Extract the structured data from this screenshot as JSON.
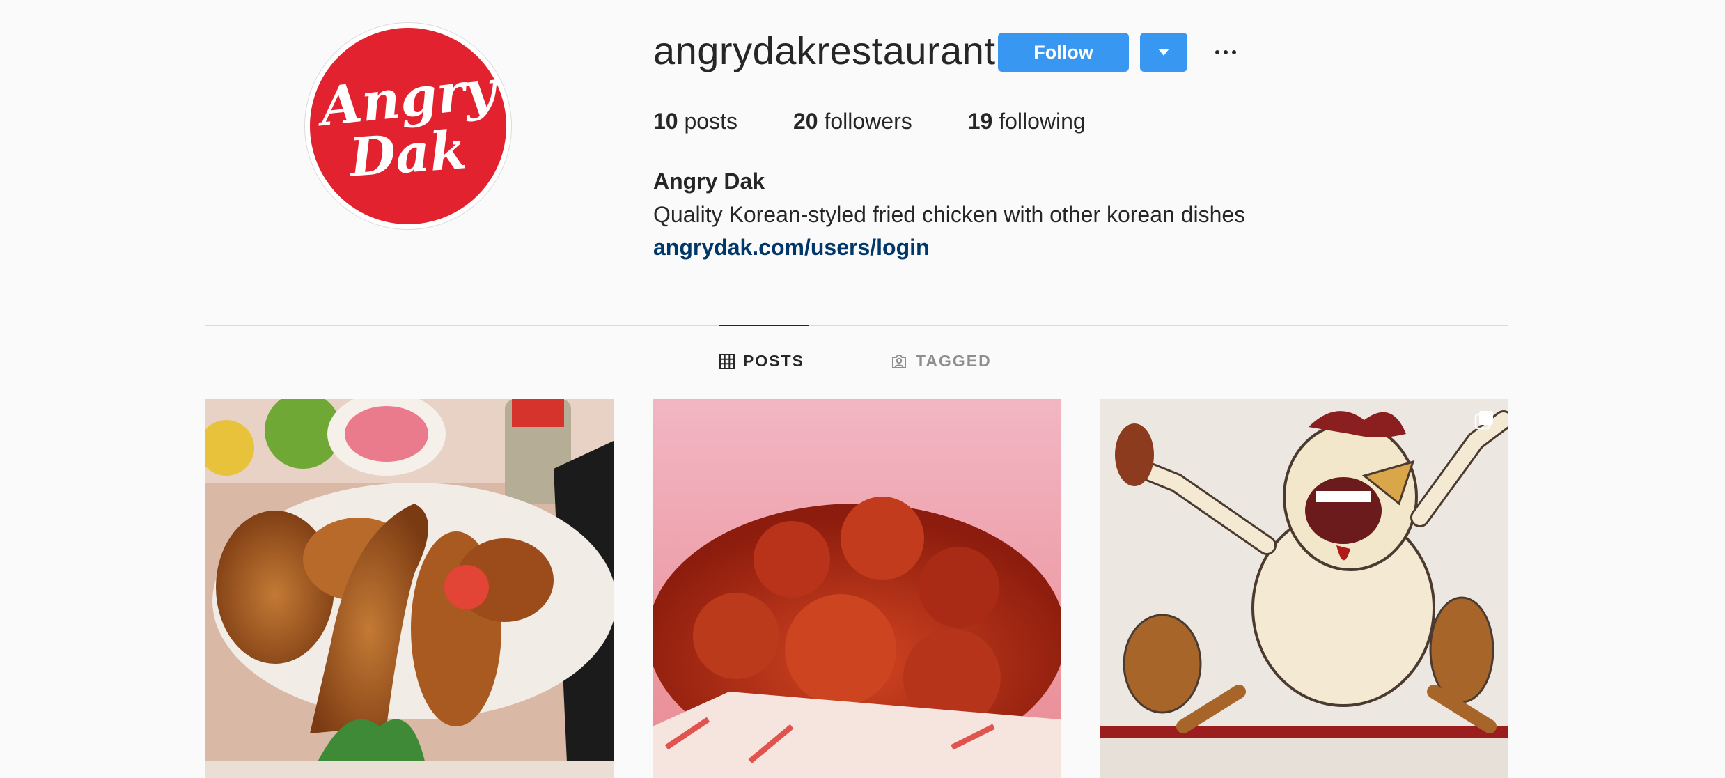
{
  "profile": {
    "avatar_text_line1": "Angry",
    "avatar_text_line2": "Dak",
    "username": "angrydakrestaurant",
    "follow_label": "Follow",
    "stats": {
      "posts_count": "10",
      "posts_label": "posts",
      "followers_count": "20",
      "followers_label": "followers",
      "following_count": "19",
      "following_label": "following"
    },
    "full_name": "Angry Dak",
    "bio": "Quality Korean-styled fried chicken with other korean dishes",
    "link": "angrydak.com/users/login"
  },
  "tabs": [
    {
      "label": "POSTS",
      "icon": "grid-icon",
      "active": true
    },
    {
      "label": "TAGGED",
      "icon": "tagged-icon",
      "active": false
    }
  ],
  "posts": [
    {
      "subject": "fried chicken platter",
      "icon": null
    },
    {
      "subject": "spicy glazed fried chicken",
      "icon": null
    },
    {
      "subject": "angry chicken mural",
      "icon": "multiple-posts-icon"
    }
  ],
  "colors": {
    "brand_red": "#e3222f",
    "follow_blue": "#3897f0",
    "link_blue": "#00376b"
  }
}
